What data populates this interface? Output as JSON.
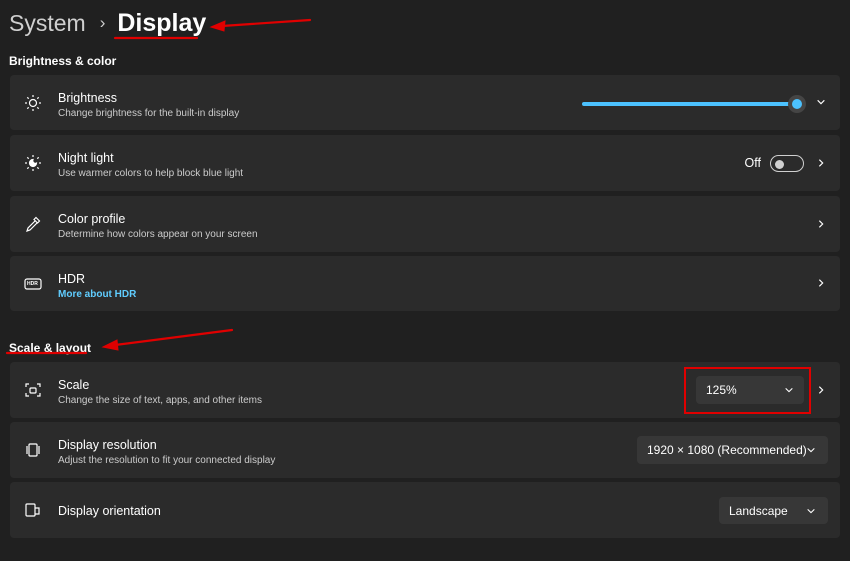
{
  "breadcrumb": {
    "parent": "System",
    "separator": "›",
    "current": "Display"
  },
  "sections": {
    "brightness_color": "Brightness & color",
    "scale_layout": "Scale & layout"
  },
  "brightness": {
    "title": "Brightness",
    "subtitle": "Change brightness for the built-in display",
    "level_percent": 100
  },
  "night_light": {
    "title": "Night light",
    "subtitle": "Use warmer colors to help block blue light",
    "state_label": "Off"
  },
  "color_profile": {
    "title": "Color profile",
    "subtitle": "Determine how colors appear on your screen"
  },
  "hdr": {
    "title": "HDR",
    "link": "More about HDR",
    "icon_text": "HDR"
  },
  "scale": {
    "title": "Scale",
    "subtitle": "Change the size of text, apps, and other items",
    "value": "125%"
  },
  "display_resolution": {
    "title": "Display resolution",
    "subtitle": "Adjust the resolution to fit your connected display",
    "value": "1920 × 1080 (Recommended)"
  },
  "display_orientation": {
    "title": "Display orientation",
    "value": "Landscape"
  },
  "colors": {
    "accent": "#4cc2ff",
    "link": "#60cdff",
    "annotation": "#e00000"
  },
  "icons": {
    "brightness": "sun-icon",
    "night_light": "night-light-icon",
    "color_profile": "eyedropper-icon",
    "hdr": "hdr-icon",
    "scale": "scale-icon",
    "resolution": "resolution-icon",
    "orientation": "orientation-icon"
  }
}
